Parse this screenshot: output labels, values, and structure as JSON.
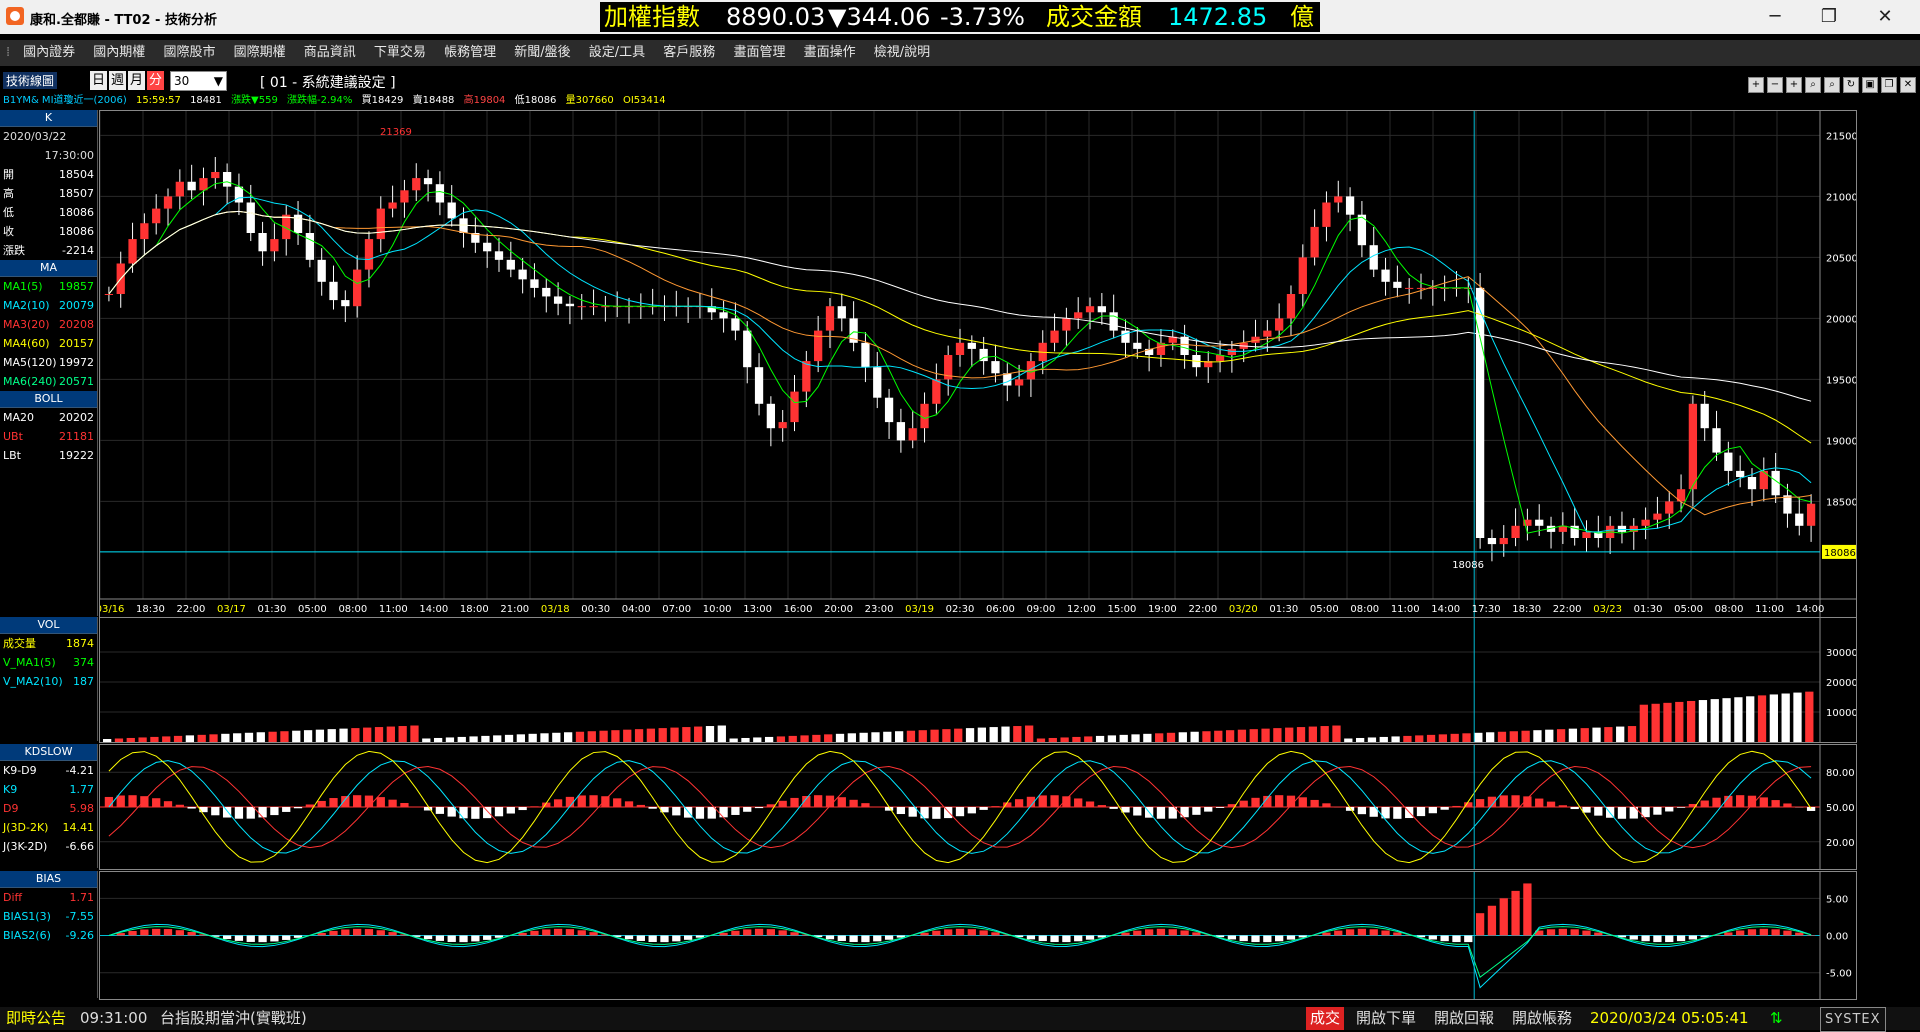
{
  "window": {
    "title": "康和.全都賺 - TT02 - 技術分析",
    "ticker_label": "加權指數",
    "ticker_value": "8890.03",
    "ticker_change": "▼344.06",
    "ticker_pct": "-3.73%",
    "turnover_label": "成交金額",
    "turnover_value": "1472.85",
    "turnover_unit": "億",
    "btn_min": "─",
    "btn_max": "❐",
    "btn_close": "✕"
  },
  "menu": [
    "國內證券",
    "國內期權",
    "國際股市",
    "國際期權",
    "商品資訊",
    "下單交易",
    "帳務管理",
    "新聞/盤後",
    "設定/工具",
    "客戶服務",
    "畫面管理",
    "畫面操作",
    "檢視/說明"
  ],
  "toolbar": {
    "chart_label": "技術線圖",
    "periods": [
      "日",
      "週",
      "月",
      "分"
    ],
    "active_period": "分",
    "interval": "30",
    "settings": "[ 01 - 系統建議設定 ]",
    "symbol": "B1YM& MI道瓊近一(2006)",
    "time": "15:59:57",
    "quote": [
      "18481",
      "漲跌▼559",
      "漲跌幅-2.94%",
      "買18429",
      "賣18488",
      "高19804",
      "低18086",
      "量307660",
      "OI53414"
    ],
    "tool_icons": [
      "+",
      "−",
      "+",
      "zoom-in",
      "zoom-out",
      "refresh",
      "save",
      "copy",
      "close"
    ]
  },
  "sidebar": {
    "k": {
      "title": "K",
      "date": "2020/03/22",
      "time": "17:30:00",
      "rows": [
        {
          "label": "開",
          "value": "18504",
          "color": "#ffffff"
        },
        {
          "label": "高",
          "value": "18507",
          "color": "#ffffff"
        },
        {
          "label": "低",
          "value": "18086",
          "color": "#ffffff"
        },
        {
          "label": "收",
          "value": "18086",
          "color": "#ffffff"
        },
        {
          "label": "漲跌",
          "value": "-2214",
          "color": "#ffffff"
        }
      ]
    },
    "ma": {
      "title": "MA",
      "rows": [
        {
          "label": "MA1(5)",
          "value": "19857",
          "color": "#00ff00"
        },
        {
          "label": "MA2(10)",
          "value": "20079",
          "color": "#00e5ff"
        },
        {
          "label": "MA3(20)",
          "value": "20208",
          "color": "#ff3333"
        },
        {
          "label": "MA4(60)",
          "value": "20157",
          "color": "#ffff00"
        },
        {
          "label": "MA5(120)",
          "value": "19972",
          "color": "#ffffff"
        },
        {
          "label": "MA6(240)",
          "value": "20571",
          "color": "#00ff88"
        }
      ]
    },
    "boll": {
      "title": "BOLL",
      "rows": [
        {
          "label": "MA20",
          "value": "20202",
          "color": "#ffffff"
        },
        {
          "label": "UBt",
          "value": "21181",
          "color": "#ff3333"
        },
        {
          "label": "LBt",
          "value": "19222",
          "color": "#ffffff"
        }
      ]
    },
    "vol": {
      "title": "VOL",
      "rows": [
        {
          "label": "成交量",
          "value": "1874",
          "color": "#ffff00"
        },
        {
          "label": "V_MA1(5)",
          "value": "374",
          "color": "#00ff00"
        },
        {
          "label": "V_MA2(10)",
          "value": "187",
          "color": "#00e5ff"
        }
      ]
    },
    "kd": {
      "title": "KDSLOW",
      "rows": [
        {
          "label": "K9-D9",
          "value": "-4.21",
          "color": "#ffffff"
        },
        {
          "label": "K9",
          "value": "1.77",
          "color": "#00e5ff"
        },
        {
          "label": "D9",
          "value": "5.98",
          "color": "#ff3333"
        },
        {
          "label": "J(3D-2K)",
          "value": "14.41",
          "color": "#ffff00"
        },
        {
          "label": "J(3K-2D)",
          "value": "-6.66",
          "color": "#ffffff"
        }
      ]
    },
    "bias": {
      "title": "BIAS",
      "rows": [
        {
          "label": "Diff",
          "value": "1.71",
          "color": "#ff3333"
        },
        {
          "label": "BIAS1(3)",
          "value": "-7.55",
          "color": "#00e5ff"
        },
        {
          "label": "BIAS2(6)",
          "value": "-9.26",
          "color": "#00e5ff"
        }
      ]
    }
  },
  "chart_data": [
    {
      "type": "candlestick",
      "ylim": [
        17700,
        21700
      ],
      "y_ticks": [
        "21500",
        "21000",
        "20500",
        "20000",
        "19500",
        "19000",
        "18500"
      ],
      "last_price": "18086",
      "cursor_low_label": "18086",
      "max_label": "21369",
      "x_ticks": [
        "03/16",
        "18:30",
        "22:00",
        "03/17",
        "01:30",
        "05:00",
        "08:00",
        "11:00",
        "14:00",
        "18:00",
        "21:00",
        "03/18",
        "00:30",
        "04:00",
        "07:00",
        "10:00",
        "13:00",
        "16:00",
        "20:00",
        "23:00",
        "03/19",
        "02:30",
        "06:00",
        "09:00",
        "12:00",
        "15:00",
        "19:00",
        "22:00",
        "03/20",
        "01:30",
        "05:00",
        "08:00",
        "11:00",
        "14:00",
        "17:30",
        "18:30",
        "22:00",
        "03/23",
        "01:30",
        "05:00",
        "08:00",
        "11:00",
        "14:00"
      ],
      "closes": [
        20200,
        20450,
        20650,
        20780,
        20900,
        21000,
        21120,
        21050,
        21150,
        21200,
        21080,
        20950,
        20700,
        20550,
        20650,
        20850,
        20700,
        20480,
        20300,
        20150,
        20100,
        20400,
        20650,
        20900,
        20950,
        21050,
        21150,
        21100,
        20950,
        20820,
        20700,
        20620,
        20550,
        20480,
        20400,
        20320,
        20250,
        20180,
        20120,
        20100,
        20100,
        20100,
        20100,
        20100,
        20100,
        20100,
        20100,
        20100,
        20100,
        20100,
        20100,
        20050,
        20000,
        19900,
        19600,
        19300,
        19100,
        19150,
        19400,
        19650,
        19900,
        20100,
        20000,
        19800,
        19600,
        19350,
        19150,
        19000,
        19100,
        19300,
        19500,
        19700,
        19800,
        19750,
        19650,
        19550,
        19450,
        19500,
        19650,
        19800,
        19900,
        20000,
        20050,
        20100,
        20050,
        19900,
        19800,
        19750,
        19700,
        19800,
        19850,
        19700,
        19600,
        19650,
        19700,
        19750,
        19800,
        19850,
        19900,
        20000,
        20200,
        20500,
        20750,
        20950,
        21000,
        20850,
        20600,
        20400,
        20300,
        20250,
        20250,
        20250,
        20250,
        20250,
        20250,
        20250,
        18200,
        18150,
        18200,
        18300,
        18350,
        18300,
        18250,
        18300,
        18200,
        18250,
        18200,
        18300,
        18250,
        18300,
        18350,
        18400,
        18500,
        18600,
        19300,
        19100,
        18900,
        18750,
        18700,
        18600,
        18750,
        18550,
        18400,
        18300,
        18481
      ],
      "kd": {
        "ylim": [
          0,
          100
        ],
        "ticks": [
          "80.00",
          "50.00",
          "20.00"
        ]
      },
      "bias": {
        "ylim": [
          -8,
          8
        ],
        "ticks": [
          "5.00",
          "0.00",
          "-5.00"
        ]
      },
      "vol": {
        "ylim": [
          0,
          40000
        ],
        "ticks": [
          "30000",
          "20000",
          "10000"
        ]
      }
    }
  ],
  "status_bar": {
    "announce_label": "即時公告",
    "announce_time": "09:31:00",
    "announce_text": "台指股期當沖(實戰班)",
    "trade_badge": "成交",
    "links": [
      "開啟下單",
      "開啟回報",
      "開啟帳務"
    ],
    "datetime": "2020/03/24 05:05:41",
    "brand": "SYSTEX"
  }
}
